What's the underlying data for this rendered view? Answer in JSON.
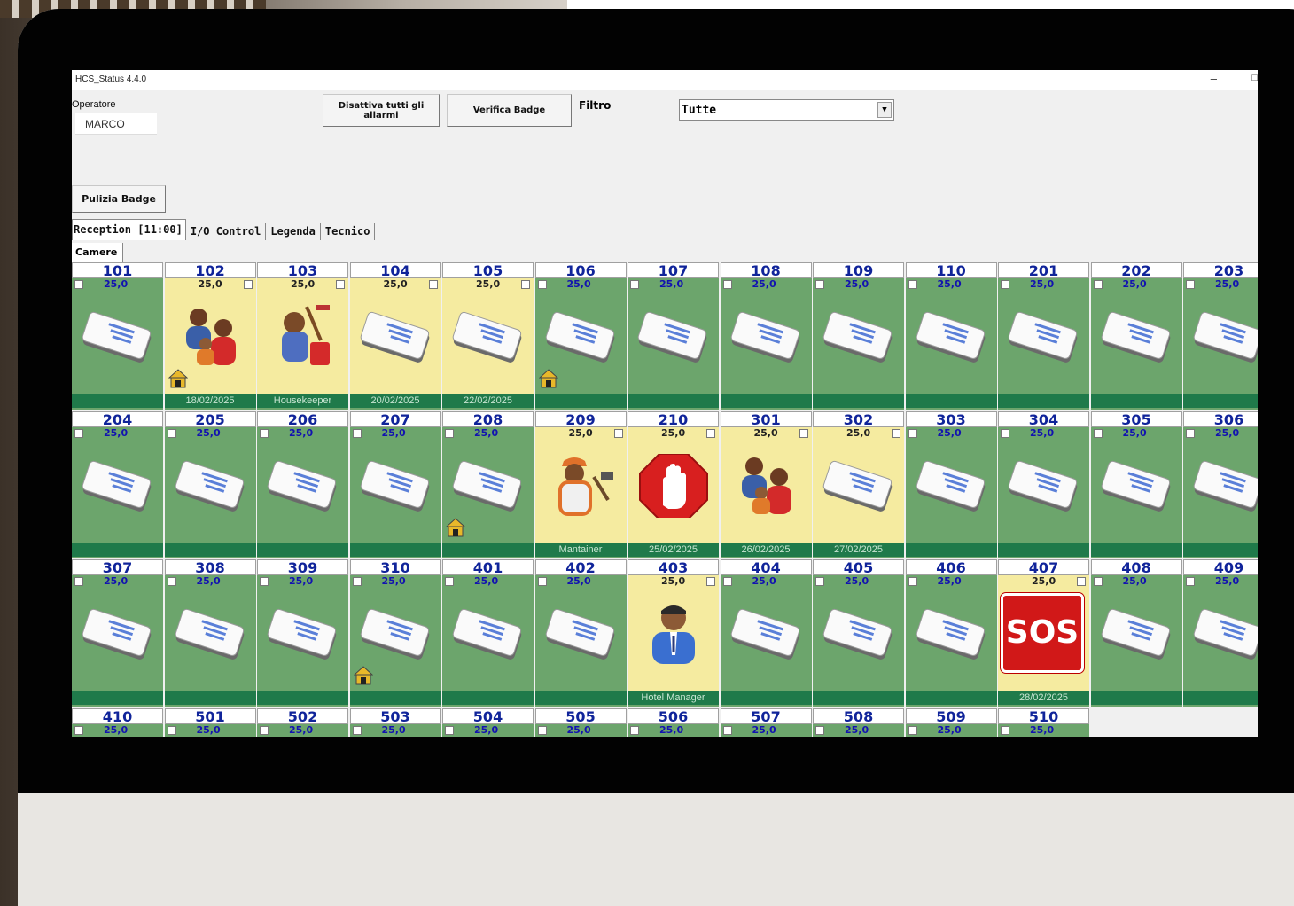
{
  "app": {
    "title": "HCS_Status 4.4.0",
    "minimize": "–",
    "maximize": "□"
  },
  "operator": {
    "label": "Operatore",
    "value": "MARCO"
  },
  "buttons": {
    "disable_alarms": "Disattiva tutti gli allarmi",
    "verify_badge": "Verifica Badge",
    "clean_badge": "Pulizia Badge"
  },
  "filter": {
    "label": "Filtro",
    "selected": "Tutte"
  },
  "tabs": [
    {
      "label": "Reception [11:00]",
      "active": true
    },
    {
      "label": "I/O Control",
      "active": false
    },
    {
      "label": "Legenda",
      "active": false
    },
    {
      "label": "Tecnico",
      "active": false
    }
  ],
  "subtab": {
    "label": "Camere"
  },
  "rooms": [
    {
      "number": "101",
      "temp": "25,0",
      "status": "green",
      "icon": "card-icon",
      "footer": ""
    },
    {
      "number": "102",
      "temp": "25,0",
      "status": "yellow",
      "icon": "guests-icon",
      "footer": "18/02/2025",
      "house": true
    },
    {
      "number": "103",
      "temp": "25,0",
      "status": "yellow",
      "icon": "housekeeper-icon",
      "footer": "Housekeeper"
    },
    {
      "number": "104",
      "temp": "25,0",
      "status": "yellow",
      "icon": "card-icon",
      "footer": "20/02/2025"
    },
    {
      "number": "105",
      "temp": "25,0",
      "status": "yellow",
      "icon": "card-icon",
      "footer": "22/02/2025"
    },
    {
      "number": "106",
      "temp": "25,0",
      "status": "green",
      "icon": "card-icon",
      "footer": "",
      "house": true
    },
    {
      "number": "107",
      "temp": "25,0",
      "status": "green",
      "icon": "card-icon",
      "footer": ""
    },
    {
      "number": "108",
      "temp": "25,0",
      "status": "green",
      "icon": "card-icon",
      "footer": ""
    },
    {
      "number": "109",
      "temp": "25,0",
      "status": "green",
      "icon": "card-icon",
      "footer": ""
    },
    {
      "number": "110",
      "temp": "25,0",
      "status": "green",
      "icon": "card-icon",
      "footer": ""
    },
    {
      "number": "201",
      "temp": "25,0",
      "status": "green",
      "icon": "card-icon",
      "footer": ""
    },
    {
      "number": "202",
      "temp": "25,0",
      "status": "green",
      "icon": "card-icon",
      "footer": ""
    },
    {
      "number": "203",
      "temp": "25,0",
      "status": "green",
      "icon": "card-icon",
      "footer": ""
    },
    {
      "number": "204",
      "temp": "25,0",
      "status": "green",
      "icon": "card-icon",
      "footer": ""
    },
    {
      "number": "205",
      "temp": "25,0",
      "status": "green",
      "icon": "card-icon",
      "footer": ""
    },
    {
      "number": "206",
      "temp": "25,0",
      "status": "green",
      "icon": "card-icon",
      "footer": ""
    },
    {
      "number": "207",
      "temp": "25,0",
      "status": "green",
      "icon": "card-icon",
      "footer": ""
    },
    {
      "number": "208",
      "temp": "25,0",
      "status": "green",
      "icon": "card-icon",
      "footer": "",
      "house": true
    },
    {
      "number": "209",
      "temp": "25,0",
      "status": "yellow",
      "icon": "maintainer-icon",
      "footer": "Mantainer"
    },
    {
      "number": "210",
      "temp": "25,0",
      "status": "yellow",
      "icon": "stop-hand-icon",
      "footer": "25/02/2025"
    },
    {
      "number": "301",
      "temp": "25,0",
      "status": "yellow",
      "icon": "guests-icon",
      "footer": "26/02/2025"
    },
    {
      "number": "302",
      "temp": "25,0",
      "status": "yellow",
      "icon": "card-icon",
      "footer": "27/02/2025"
    },
    {
      "number": "303",
      "temp": "25,0",
      "status": "green",
      "icon": "card-icon",
      "footer": ""
    },
    {
      "number": "304",
      "temp": "25,0",
      "status": "green",
      "icon": "card-icon",
      "footer": ""
    },
    {
      "number": "305",
      "temp": "25,0",
      "status": "green",
      "icon": "card-icon",
      "footer": ""
    },
    {
      "number": "306",
      "temp": "25,0",
      "status": "green",
      "icon": "card-icon",
      "footer": ""
    },
    {
      "number": "307",
      "temp": "25,0",
      "status": "green",
      "icon": "card-icon",
      "footer": ""
    },
    {
      "number": "308",
      "temp": "25,0",
      "status": "green",
      "icon": "card-icon",
      "footer": ""
    },
    {
      "number": "309",
      "temp": "25,0",
      "status": "green",
      "icon": "card-icon",
      "footer": ""
    },
    {
      "number": "310",
      "temp": "25,0",
      "status": "green",
      "icon": "card-icon",
      "footer": "",
      "house": true
    },
    {
      "number": "401",
      "temp": "25,0",
      "status": "green",
      "icon": "card-icon",
      "footer": ""
    },
    {
      "number": "402",
      "temp": "25,0",
      "status": "green",
      "icon": "card-icon",
      "footer": ""
    },
    {
      "number": "403",
      "temp": "25,0",
      "status": "yellow",
      "icon": "hotel-manager-icon",
      "footer": "Hotel Manager"
    },
    {
      "number": "404",
      "temp": "25,0",
      "status": "green",
      "icon": "card-icon",
      "footer": ""
    },
    {
      "number": "405",
      "temp": "25,0",
      "status": "green",
      "icon": "card-icon",
      "footer": ""
    },
    {
      "number": "406",
      "temp": "25,0",
      "status": "green",
      "icon": "card-icon",
      "footer": ""
    },
    {
      "number": "407",
      "temp": "25,0",
      "status": "yellow",
      "icon": "sos-icon",
      "footer": "28/02/2025",
      "sos_text": "SOS"
    },
    {
      "number": "408",
      "temp": "25,0",
      "status": "green",
      "icon": "card-icon",
      "footer": ""
    },
    {
      "number": "409",
      "temp": "25,0",
      "status": "green",
      "icon": "card-icon",
      "footer": ""
    },
    {
      "number": "410",
      "temp": "25,0",
      "status": "green",
      "icon": "card-icon",
      "footer": ""
    },
    {
      "number": "501",
      "temp": "25,0",
      "status": "green",
      "icon": "card-icon",
      "footer": ""
    },
    {
      "number": "502",
      "temp": "25,0",
      "status": "green",
      "icon": "card-icon",
      "footer": ""
    },
    {
      "number": "503",
      "temp": "25,0",
      "status": "green",
      "icon": "card-icon",
      "footer": ""
    },
    {
      "number": "504",
      "temp": "25,0",
      "status": "green",
      "icon": "card-icon",
      "footer": ""
    },
    {
      "number": "505",
      "temp": "25,0",
      "status": "green",
      "icon": "card-icon",
      "footer": ""
    },
    {
      "number": "506",
      "temp": "25,0",
      "status": "green",
      "icon": "card-icon",
      "footer": ""
    },
    {
      "number": "507",
      "temp": "25,0",
      "status": "green",
      "icon": "card-icon",
      "footer": ""
    },
    {
      "number": "508",
      "temp": "25,0",
      "status": "green",
      "icon": "card-icon",
      "footer": ""
    },
    {
      "number": "509",
      "temp": "25,0",
      "status": "green",
      "icon": "card-icon",
      "footer": ""
    },
    {
      "number": "510",
      "temp": "25,0",
      "status": "green",
      "icon": "card-icon",
      "footer": ""
    }
  ],
  "colors": {
    "free": "#6ca56c",
    "occupied": "#f5eba0",
    "footer": "#1f7a4a",
    "room_number": "#10249a"
  }
}
